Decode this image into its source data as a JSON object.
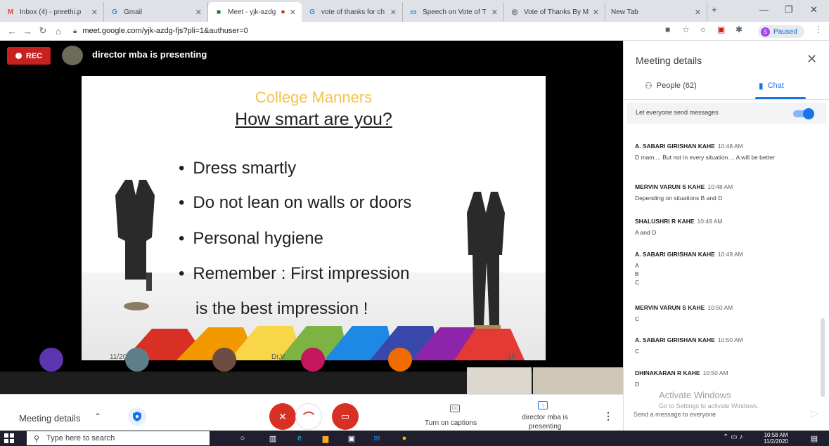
{
  "browser": {
    "tabs": [
      {
        "label": "Inbox (4) - preethi.p",
        "icon": "gmail-icon"
      },
      {
        "label": "Gmail",
        "icon": "google-icon"
      },
      {
        "label": "Meet - yjk-azdg",
        "icon": "meet-icon",
        "active": true
      },
      {
        "label": "vote of thanks for ch",
        "icon": "google-icon"
      },
      {
        "label": "Speech on Vote of T",
        "icon": "speech-icon"
      },
      {
        "label": "Vote of Thanks By M",
        "icon": "globe-icon"
      },
      {
        "label": "New Tab",
        "icon": ""
      }
    ],
    "url": "meet.google.com/yjk-azdg-fjs?pli=1&authuser=0",
    "profile_initial": "S",
    "profile_status": "Paused"
  },
  "meet": {
    "rec_label": "REC",
    "presenter_banner": "director mba is presenting",
    "slide": {
      "title": "College Manners",
      "subtitle": "How smart are you?",
      "bullets": [
        "Dress smartly",
        "Do not lean on walls or doors",
        "Personal hygiene",
        "Remember : First impression",
        "is the best impression !"
      ],
      "footer_date": "11/",
      "footer_year": "2020",
      "footer_author": "Dr.V",
      "footer_page": "15"
    },
    "controls": {
      "meeting_details_label": "Meeting details",
      "captions_label": "Turn on captions",
      "captions_icon_text": "CC",
      "presenting_label": "director mba is presenting"
    }
  },
  "panel": {
    "title": "Meeting details",
    "people_tab": "People (62)",
    "chat_tab": "Chat",
    "toggle_label": "Let everyone send messages",
    "toggle_on": true,
    "messages": [
      {
        "sender": "A. SABARI GIRISHAN KAHE",
        "time": "10:48 AM",
        "text": "D mam.... But not in every situation.... A will be better"
      },
      {
        "sender": "MERVIN VARUN S KAHE",
        "time": "10:48 AM",
        "text": "Depending on situations B and D"
      },
      {
        "sender": "SHALUSHRI R KAHE",
        "time": "10:49 AM",
        "text": "A and D"
      },
      {
        "sender": "A. SABARI GIRISHAN KAHE",
        "time": "10:49 AM",
        "text": "A\nB\nC"
      },
      {
        "sender": "MERVIN VARUN S KAHE",
        "time": "10:50 AM",
        "text": "C"
      },
      {
        "sender": "A. SABARI GIRISHAN KAHE",
        "time": "10:50 AM",
        "text": "C"
      },
      {
        "sender": "DHINAKARAN R KAHE",
        "time": "10:50 AM",
        "text": "D"
      }
    ],
    "watermark_title": "Activate Windows",
    "watermark_sub": "Go to Settings to activate Windows.",
    "input_placeholder": "Send a message to everyone"
  },
  "taskbar": {
    "search_placeholder": "Type here to search",
    "time": "10:58 AM",
    "date": "11/2/2020"
  },
  "colors": {
    "accent": "#1a73e8",
    "danger": "#d93025",
    "slide_title": "#f5c24a"
  }
}
